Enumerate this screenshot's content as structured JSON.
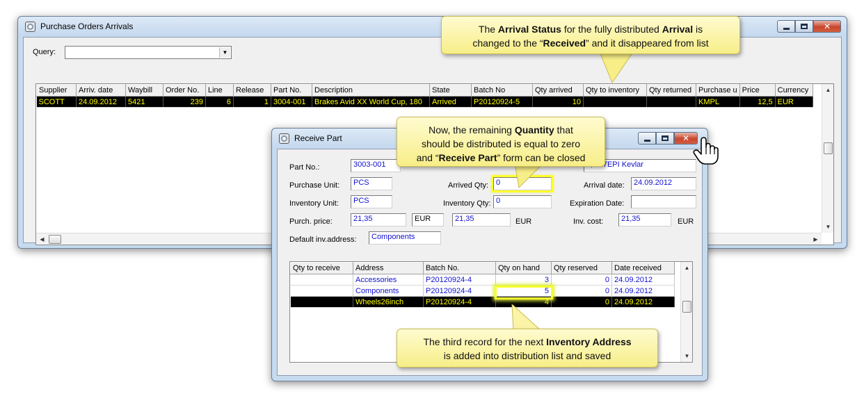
{
  "main_window": {
    "title": "Purchase Orders Arrivals",
    "query_label": "Query:",
    "query_value": "",
    "columns": [
      "Supplier",
      "Arriv. date",
      "Waybill",
      "Order No.",
      "Line",
      "Release",
      "Part No.",
      "Description",
      "State",
      "Batch No",
      "Qty arrived",
      "Qty to inventory",
      "Qty returned",
      "Purchase u",
      "Price",
      "Currency"
    ],
    "rows": [
      {
        "supplier": "SCOTT",
        "arriv_date": "24.09.2012",
        "waybill": "5421",
        "order_no": "239",
        "line": "6",
        "release": "1",
        "part_no": "3004-001",
        "description": "Brakes Avid XX World Cup, 180",
        "state": "Arrived",
        "batch_no": "P20120924-5",
        "qty_arrived": "10",
        "qty_to_inventory": "",
        "qty_returned": "",
        "purchase_unit": "KMPL",
        "price": "12,5",
        "currency": "EUR"
      }
    ]
  },
  "receive_window": {
    "title": "Receive Part",
    "part_no_label": "Part No.:",
    "part_no_value": "3003-001",
    "description_value": "s, 127EPI Kevlar",
    "purchase_unit_label": "Purchase Unit:",
    "purchase_unit_value": "PCS",
    "arrived_qty_label": "Arrived Qty:",
    "arrived_qty_value": "0",
    "arrival_date_label": "Arrival date:",
    "arrival_date_value": "24.09.2012",
    "inventory_unit_label": "Inventory Unit:",
    "inventory_unit_value": "PCS",
    "inventory_qty_label": "Inventory Qty:",
    "inventory_qty_value": "0",
    "expiration_date_label": "Expiration Date:",
    "expiration_date_value": "",
    "purch_price_label": "Purch. price:",
    "purch_price_value": "21,35",
    "purch_currency": "EUR",
    "purch_price_2": "21,35",
    "purch_currency_2": "EUR",
    "inv_cost_label": "Inv. cost:",
    "inv_cost_value": "21,35",
    "inv_cost_currency": "EUR",
    "default_address_label": "Default inv.address:",
    "default_address_value": "Components",
    "columns": [
      "Qty to receive",
      "Address",
      "Batch No.",
      "Qty on hand",
      "Qty reserved",
      "Date received"
    ],
    "rows": [
      {
        "qty_to_receive": "",
        "address": "Accessories",
        "batch_no": "P20120924-4",
        "qty_on_hand": "3",
        "qty_reserved": "0",
        "date_received": "24.09.2012"
      },
      {
        "qty_to_receive": "",
        "address": "Components",
        "batch_no": "P20120924-4",
        "qty_on_hand": "5",
        "qty_reserved": "0",
        "date_received": "24.09.2012"
      },
      {
        "qty_to_receive": "",
        "address": "Wheels26inch",
        "batch_no": "P20120924-4",
        "qty_on_hand": "4",
        "qty_reserved": "0",
        "date_received": "24.09.2012"
      }
    ]
  },
  "callouts": {
    "top": {
      "l1a": "The ",
      "l1b": "Arrival Status",
      "l1c": " for the fully distributed ",
      "l1d": "Arrival",
      "l1e": " is",
      "l2a": "changed to the “",
      "l2b": "Received",
      "l2c": "” and it disappeared from list"
    },
    "middle": {
      "l1": "Now, the remaining ",
      "l1b": "Quantity",
      "l1c": " that",
      "l2": "should be distributed is equal to zero",
      "l3a": "and “",
      "l3b": "Receive Part",
      "l3c": "” form can be closed"
    },
    "bottom": {
      "l1a": "The third record for the next ",
      "l1b": "Inventory Address",
      "l2": "is added into distribution list and saved"
    }
  },
  "colors": {
    "callout_fill": "#f9f199",
    "highlight": "#ffff2a",
    "selected_row": "#000000",
    "selected_text": "#ffff00",
    "field_text": "#1010d0"
  },
  "icons": [
    "app-icon",
    "minimize-icon",
    "maximize-icon",
    "close-icon",
    "dropdown-arrow-icon",
    "hand-cursor-icon"
  ]
}
